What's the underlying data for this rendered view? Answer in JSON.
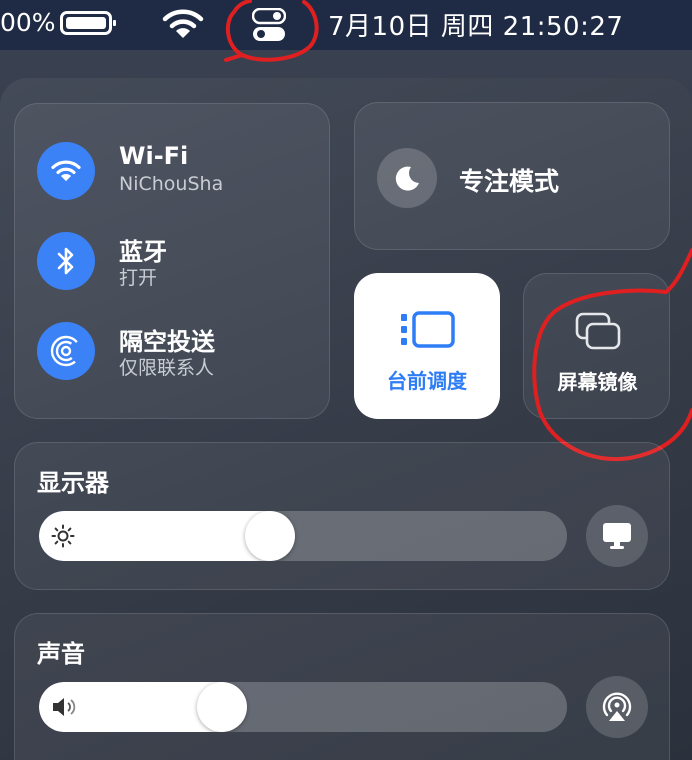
{
  "menubar": {
    "battery_text": "00%",
    "datetime": "7月10日 周四  21:50:27",
    "icons": [
      "battery-icon",
      "wifi-icon",
      "control-center-icon"
    ]
  },
  "connectivity": {
    "wifi": {
      "title": "Wi-Fi",
      "subtitle": "NiChouSha"
    },
    "bluetooth": {
      "title": "蓝牙",
      "subtitle": "打开"
    },
    "airdrop": {
      "title": "隔空投送",
      "subtitle": "仅限联系人"
    }
  },
  "focus": {
    "label": "专注模式"
  },
  "stage_manager": {
    "label": "台前调度"
  },
  "screen_mirroring": {
    "label": "屏幕镜像"
  },
  "display": {
    "title": "显示器",
    "brightness": 0.43
  },
  "sound": {
    "title": "声音",
    "volume": 0.33
  },
  "colors": {
    "accent": "#3b82f6",
    "stage_label": "#2f7df6",
    "annotation": "#e02020",
    "menubar": "#1f2b44"
  }
}
